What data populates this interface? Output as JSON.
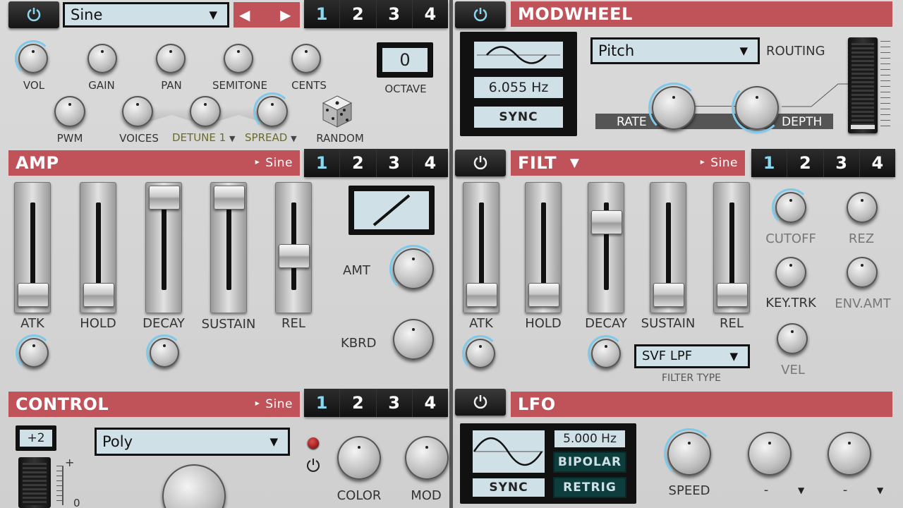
{
  "colors": {
    "header": "#c0525a",
    "lcd": "#cfe0e6",
    "accent": "#8ad8f0"
  },
  "osc": {
    "waveform": "Sine",
    "prev_icon": "triangle-left-icon",
    "next_icon": "triangle-right-icon",
    "tabs": [
      "1",
      "2",
      "3",
      "4"
    ],
    "octave_value": "0",
    "octave_label": "OCTAVE",
    "knobs": [
      "VOL",
      "GAIN",
      "PAN",
      "SEMITONE",
      "CENTS"
    ],
    "row2": [
      "PWM",
      "VOICES"
    ],
    "detune": "DETUNE 1",
    "spread": "SPREAD",
    "random": "RANDOM"
  },
  "amp": {
    "title": "AMP",
    "wave": "Sine",
    "tabs": [
      "1",
      "2",
      "3",
      "4"
    ],
    "faders": [
      "ATK",
      "HOLD",
      "DECAY",
      "SUSTAIN",
      "REL"
    ],
    "fader_levels": [
      0.0,
      0.0,
      1.0,
      1.0,
      0.4
    ],
    "amt": "AMT",
    "kbrd": "KBRD"
  },
  "control": {
    "title": "CONTROL",
    "wave": "Sine",
    "tabs": [
      "1",
      "2",
      "3",
      "4"
    ],
    "transpose": "+2",
    "mode": "Poly",
    "plus": "+",
    "zero": "0",
    "color": "COLOR",
    "mod": "MOD"
  },
  "modwheel": {
    "title": "MODWHEEL",
    "rate_value": "6.055 Hz",
    "sync": "SYNC",
    "routing_value": "Pitch",
    "routing_label": "ROUTING",
    "rate": "RATE",
    "depth": "DEPTH"
  },
  "filt": {
    "title": "FILT",
    "wave": "Sine",
    "tabs": [
      "1",
      "2",
      "3",
      "4"
    ],
    "faders": [
      "ATK",
      "HOLD",
      "DECAY",
      "SUSTAIN",
      "REL"
    ],
    "fader_levels": [
      0.0,
      0.0,
      0.75,
      0.0,
      0.0
    ],
    "cutoff": "CUTOFF",
    "rez": "REZ",
    "keytrk": "KEY.TRK",
    "envamt": "ENV.AMT",
    "vel": "VEL",
    "filter_type": "SVF LPF",
    "filter_type_label": "FILTER TYPE"
  },
  "lfo": {
    "title": "LFO",
    "rate_value": "5.000 Hz",
    "bipolar": "BIPOLAR",
    "sync": "SYNC",
    "retrig": "RETRIG",
    "speed": "SPEED",
    "dest1": "-",
    "dest2": "-"
  }
}
